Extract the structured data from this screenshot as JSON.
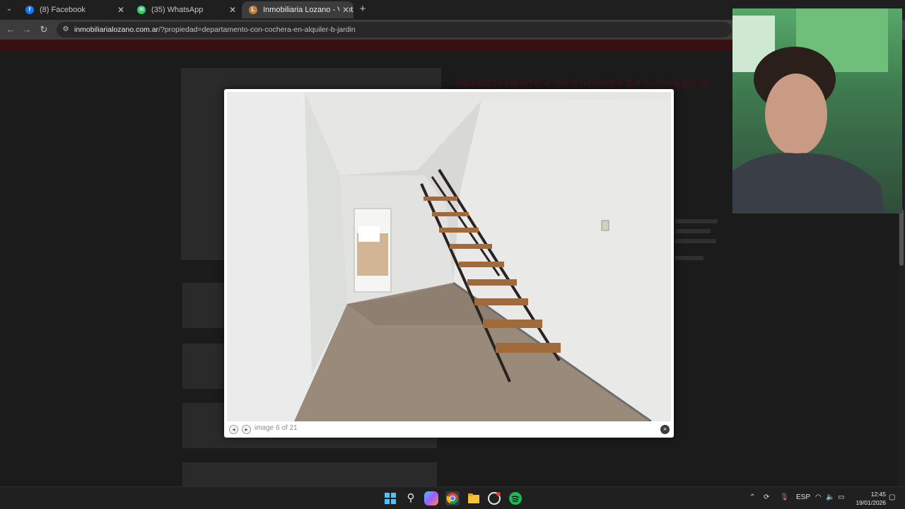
{
  "browser": {
    "tabs": [
      {
        "title": "(8) Facebook",
        "favicon": "facebook-icon",
        "favicon_letter": "f",
        "color": "#1877f2",
        "active": false
      },
      {
        "title": "(35) WhatsApp",
        "favicon": "whatsapp-icon",
        "favicon_letter": "35",
        "color": "#25d366",
        "active": false
      },
      {
        "title": "Inmobiliaria Lozano - Venta y Al",
        "favicon": "lozano-site-icon",
        "favicon_letter": "L",
        "color": "#c47f3c",
        "active": true
      }
    ],
    "url_host": "inmobiliarialozano.com.ar",
    "url_path": "/?propiedad=departamento-con-cochera-en-alquiler-b-jardin"
  },
  "page": {
    "background_title": "DEPARTAMENTO CON COCHERA EN ALQUILER B°"
  },
  "lightbox": {
    "counter": "image 6 of 21",
    "prev_label": "◂",
    "next_label": "▸",
    "close_label": "×"
  },
  "taskbar": {
    "language": "ESP",
    "time": "12:45",
    "date": "19/01/2026",
    "pinned": [
      "windows-start-icon",
      "search-icon",
      "copilot-icon",
      "chrome-icon",
      "file-explorer-icon",
      "obs-icon",
      "spotify-icon"
    ]
  },
  "colors": {
    "accent_red": "#3a0f13",
    "chrome_bg": "#1f1f1f",
    "spotify": "#1db954"
  }
}
